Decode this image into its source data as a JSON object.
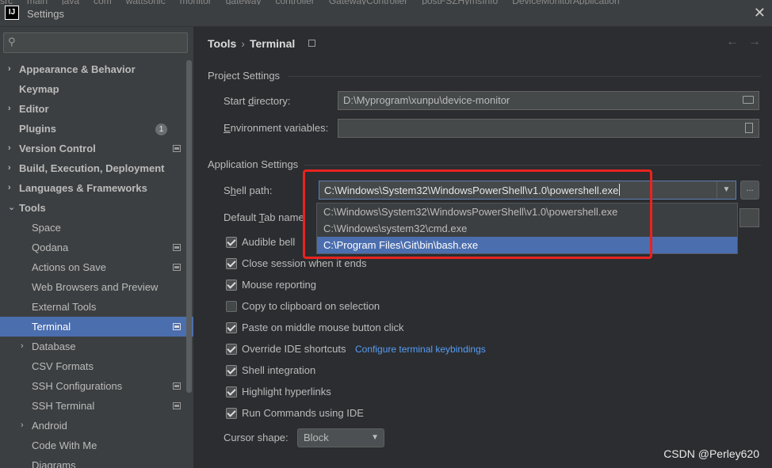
{
  "window": {
    "logo": "IJ",
    "title": "Settings",
    "close": "✕",
    "background_tabs": [
      "src",
      "main",
      "java",
      "com",
      "wattsonic",
      "monitor",
      "gateway",
      "controller",
      "GatewayController",
      "postFSZHymsInfo",
      "DeviceMonitorApplication"
    ]
  },
  "sidebar": {
    "search": {
      "placeholder": "",
      "value": "",
      "icon": "search-icon"
    },
    "items": [
      {
        "label": "Appearance & Behavior",
        "chevron": "›",
        "bold": true,
        "indent": 0
      },
      {
        "label": "Keymap",
        "chevron": "",
        "bold": true,
        "indent": 0
      },
      {
        "label": "Editor",
        "chevron": "›",
        "bold": true,
        "indent": 0
      },
      {
        "label": "Plugins",
        "chevron": "",
        "bold": true,
        "indent": 0,
        "badge": "1"
      },
      {
        "label": "Version Control",
        "chevron": "›",
        "bold": true,
        "indent": 0,
        "proj": true
      },
      {
        "label": "Build, Execution, Deployment",
        "chevron": "›",
        "bold": true,
        "indent": 0
      },
      {
        "label": "Languages & Frameworks",
        "chevron": "›",
        "bold": true,
        "indent": 0
      },
      {
        "label": "Tools",
        "chevron": "⌄",
        "bold": true,
        "indent": 0
      },
      {
        "label": "Space",
        "chevron": "",
        "bold": false,
        "indent": 1
      },
      {
        "label": "Qodana",
        "chevron": "",
        "bold": false,
        "indent": 1,
        "proj": true
      },
      {
        "label": "Actions on Save",
        "chevron": "",
        "bold": false,
        "indent": 1,
        "proj": true
      },
      {
        "label": "Web Browsers and Preview",
        "chevron": "",
        "bold": false,
        "indent": 1
      },
      {
        "label": "External Tools",
        "chevron": "",
        "bold": false,
        "indent": 1
      },
      {
        "label": "Terminal",
        "chevron": "",
        "bold": false,
        "indent": 1,
        "proj": true,
        "selected": true
      },
      {
        "label": "Database",
        "chevron": "›",
        "bold": false,
        "indent": 1
      },
      {
        "label": "CSV Formats",
        "chevron": "",
        "bold": false,
        "indent": 1
      },
      {
        "label": "SSH Configurations",
        "chevron": "",
        "bold": false,
        "indent": 1,
        "proj": true
      },
      {
        "label": "SSH Terminal",
        "chevron": "",
        "bold": false,
        "indent": 1,
        "proj": true
      },
      {
        "label": "Android",
        "chevron": "›",
        "bold": false,
        "indent": 1
      },
      {
        "label": "Code With Me",
        "chevron": "",
        "bold": false,
        "indent": 1
      },
      {
        "label": "Diagrams",
        "chevron": "",
        "bold": false,
        "indent": 1
      }
    ]
  },
  "header": {
    "breadcrumb_parent": "Tools",
    "breadcrumb_sep": "›",
    "breadcrumb_current": "Terminal",
    "back": "←",
    "forward": "→"
  },
  "project_settings": {
    "title": "Project Settings",
    "start_directory_label_pre": "Start ",
    "start_directory_label_mnemonic": "d",
    "start_directory_label_post": "irectory:",
    "start_directory_value": "D:\\Myprogram\\xunpu\\device-monitor",
    "env_label_mnemonic": "E",
    "env_label_post": "nvironment variables:",
    "env_value": ""
  },
  "application_settings": {
    "title": "Application Settings",
    "shell_label_pre": "S",
    "shell_label_mnemonic": "h",
    "shell_label_post": "ell path:",
    "shell_value": "C:\\Windows\\System32\\WindowsPowerShell\\v1.0\\powershell.exe",
    "browse": "...",
    "shell_options": [
      "C:\\Windows\\System32\\WindowsPowerShell\\v1.0\\powershell.exe",
      "C:\\Windows\\system32\\cmd.exe",
      "C:\\Program Files\\Git\\bin\\bash.exe"
    ],
    "shell_selected_index": 2,
    "default_tab_label_pre": "Default ",
    "default_tab_label_mnemonic": "T",
    "default_tab_label_post": "ab name",
    "checkboxes": [
      {
        "label": "Audible bell",
        "checked": true
      },
      {
        "label": "Close session when it ends",
        "checked": true
      },
      {
        "label": "Mouse reporting",
        "checked": true
      },
      {
        "label": "Copy to clipboard on selection",
        "checked": false
      },
      {
        "label": "Paste on middle mouse button click",
        "checked": true
      },
      {
        "label": "Override IDE shortcuts",
        "checked": true,
        "link": "Configure terminal keybindings"
      },
      {
        "label": "Shell integration",
        "checked": true
      },
      {
        "label": "Highlight hyperlinks",
        "checked": true
      },
      {
        "label": "Run Commands using IDE",
        "checked": true
      }
    ],
    "cursor_shape_label": "Cursor shape:",
    "cursor_shape_value": "Block"
  },
  "watermark": "CSDN @Perley620",
  "colors": {
    "selection": "#4b6eaf",
    "highlight_box": "#e8231f",
    "link": "#589df6",
    "background": "#2b2d30",
    "sidebar": "#3c3f41"
  }
}
